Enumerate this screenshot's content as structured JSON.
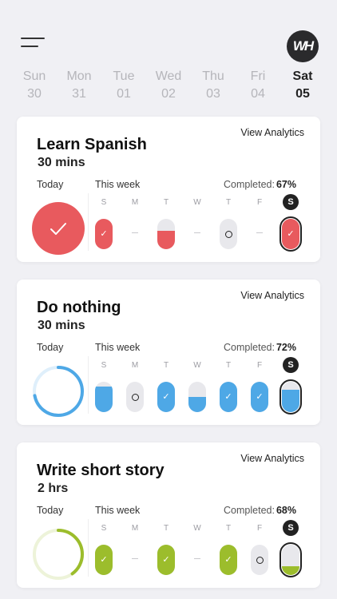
{
  "header": {
    "menu_icon": "hamburger-menu-icon",
    "avatar_text": "WH"
  },
  "days": [
    {
      "name": "Sun",
      "num": "30"
    },
    {
      "name": "Mon",
      "num": "31"
    },
    {
      "name": "Tue",
      "num": "01"
    },
    {
      "name": "Wed",
      "num": "02"
    },
    {
      "name": "Thu",
      "num": "03"
    },
    {
      "name": "Fri",
      "num": "04"
    },
    {
      "name": "Sat",
      "num": "05",
      "selected": true
    }
  ],
  "week_letters": [
    "S",
    "M",
    "T",
    "W",
    "T",
    "F",
    "S"
  ],
  "habits": [
    {
      "title": "Learn Spanish",
      "duration": "30 mins",
      "analytics": "View Analytics",
      "today_label": "Today",
      "week_label": "This week",
      "completed_label": "Completed:",
      "completed_value": "67%",
      "color": "#e85a5e",
      "today_state": "done",
      "today_progress": 1.0,
      "week": [
        {
          "state": "done"
        },
        {
          "state": "none"
        },
        {
          "state": "partial",
          "fill": 0.6
        },
        {
          "state": "none"
        },
        {
          "state": "skipped"
        },
        {
          "state": "none"
        },
        {
          "state": "done",
          "current": true
        }
      ]
    },
    {
      "title": "Do nothing",
      "duration": "30 mins",
      "analytics": "View Analytics",
      "today_label": "Today",
      "week_label": "This week",
      "completed_label": "Completed:",
      "completed_value": "72%",
      "color": "#4ea8e6",
      "today_state": "progress",
      "today_progress": 0.72,
      "week": [
        {
          "state": "partial",
          "fill": 0.85
        },
        {
          "state": "skipped"
        },
        {
          "state": "done"
        },
        {
          "state": "partial",
          "fill": 0.5
        },
        {
          "state": "done"
        },
        {
          "state": "done"
        },
        {
          "state": "partial",
          "fill": 0.75,
          "current": true
        }
      ]
    },
    {
      "title": "Write short story",
      "duration": "2 hrs",
      "analytics": "View Analytics",
      "today_label": "Today",
      "week_label": "This week",
      "completed_label": "Completed:",
      "completed_value": "68%",
      "color": "#9cbd2c",
      "today_state": "progress",
      "today_progress": 0.4,
      "week": [
        {
          "state": "done"
        },
        {
          "state": "none"
        },
        {
          "state": "done"
        },
        {
          "state": "none"
        },
        {
          "state": "done"
        },
        {
          "state": "skipped"
        },
        {
          "state": "partial",
          "fill": 0.3,
          "current": true
        }
      ]
    }
  ]
}
